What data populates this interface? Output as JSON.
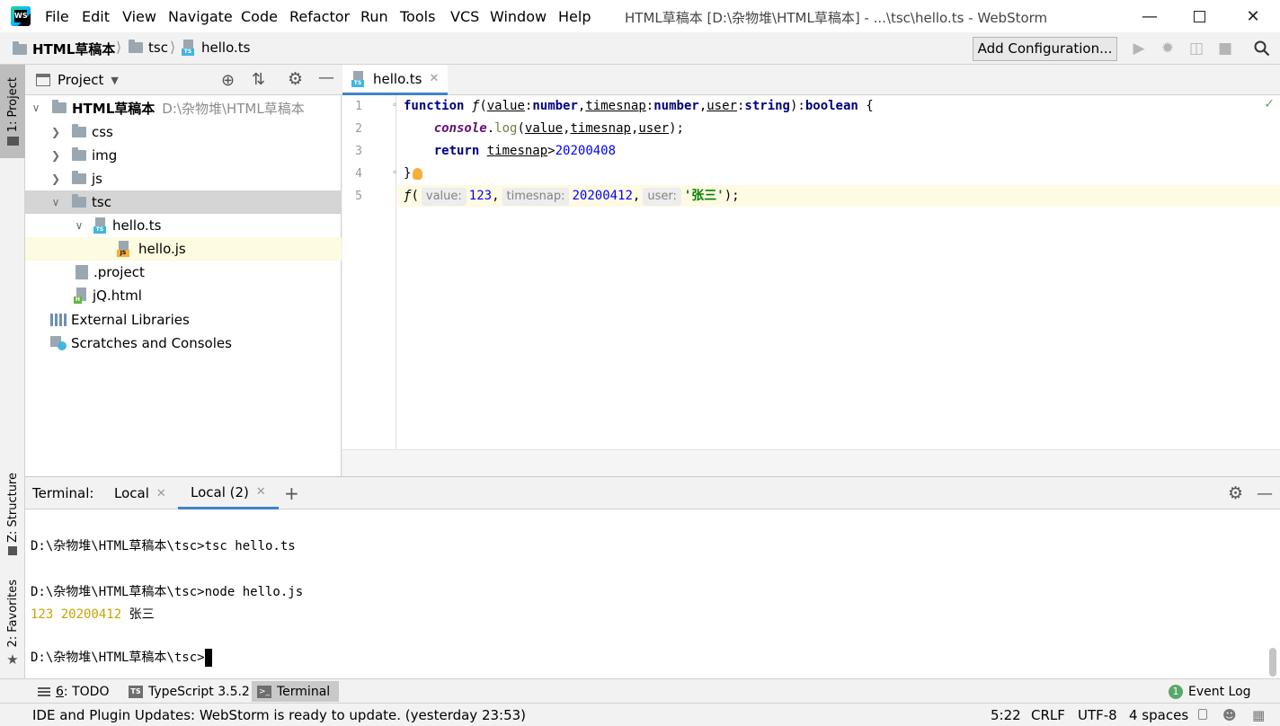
{
  "menu": {
    "items": [
      "File",
      "Edit",
      "View",
      "Navigate",
      "Code",
      "Refactor",
      "Run",
      "Tools",
      "VCS",
      "Window",
      "Help"
    ]
  },
  "window_title": "HTML草稿本 [D:\\杂物堆\\HTML草稿本] - ...\\tsc\\hello.ts - WebStorm",
  "app_logo": "WS",
  "navbar": {
    "crumbs": [
      "HTML草稿本",
      "tsc",
      "hello.ts"
    ],
    "add_configuration": "Add Configuration..."
  },
  "left_strip": {
    "project_tab": "1: Project",
    "structure_tab": "Z: Structure",
    "favorites_tab": "2: Favorites"
  },
  "project_panel": {
    "title": "Project",
    "root_name": "HTML草稿本",
    "root_path": "D:\\杂物堆\\HTML草稿本",
    "items": {
      "css": "css",
      "img": "img",
      "js": "js",
      "tsc": "tsc",
      "hello_ts": "hello.ts",
      "hello_js": "hello.js",
      "project_file": ".project",
      "jq_html": "jQ.html",
      "external_libraries": "External Libraries",
      "scratches": "Scratches and Consoles"
    }
  },
  "editor": {
    "tab_label": "hello.ts",
    "line_numbers": [
      "1",
      "2",
      "3",
      "4",
      "5"
    ],
    "line1": {
      "kw_function": "function",
      "fname": "ƒ",
      "p_value": "value",
      "t_number1": "number",
      "p_timesnap": "timesnap",
      "t_number2": "number",
      "p_user": "user",
      "t_string": "string",
      "t_boolean": "boolean"
    },
    "line2": {
      "console": "console",
      "log": "log",
      "a1": "value",
      "a2": "timesnap",
      "a3": "user"
    },
    "line3": {
      "kw_return": "return",
      "var": "timesnap",
      "num": "20200408"
    },
    "line4": {
      "brace": "}"
    },
    "line5": {
      "fname": "ƒ",
      "hint_value": "value:",
      "arg1": "123",
      "hint_timesnap": "timesnap:",
      "arg2": "20200412",
      "hint_user": "user:",
      "arg3": "'张三'"
    }
  },
  "terminal": {
    "label": "Terminal:",
    "tabs": [
      "Local",
      "Local (2)"
    ],
    "lines": [
      "D:\\杂物堆\\HTML草稿本\\tsc>tsc hello.ts",
      "D:\\杂物堆\\HTML草稿本\\tsc>node hello.js",
      "D:\\杂物堆\\HTML草稿本\\tsc>"
    ],
    "output_numbers": "123 20200412",
    "output_name": "张三"
  },
  "toolbar": {
    "todo_num": "6",
    "todo": ": TODO",
    "typescript": "TypeScript 3.5.2",
    "terminal": "Terminal",
    "event_log_count": "1",
    "event_log": "Event Log"
  },
  "status": {
    "message": "IDE and Plugin Updates: WebStorm is ready to update. (yesterday 23:53)",
    "position": "5:22",
    "line_sep": "CRLF",
    "encoding": "UTF-8",
    "indent": "4 spaces"
  },
  "colors": {
    "accent": "#4083c9",
    "current_line": "#fffae3",
    "selected_row": "#d5d5d5",
    "terminal_output": "#c7a300"
  }
}
